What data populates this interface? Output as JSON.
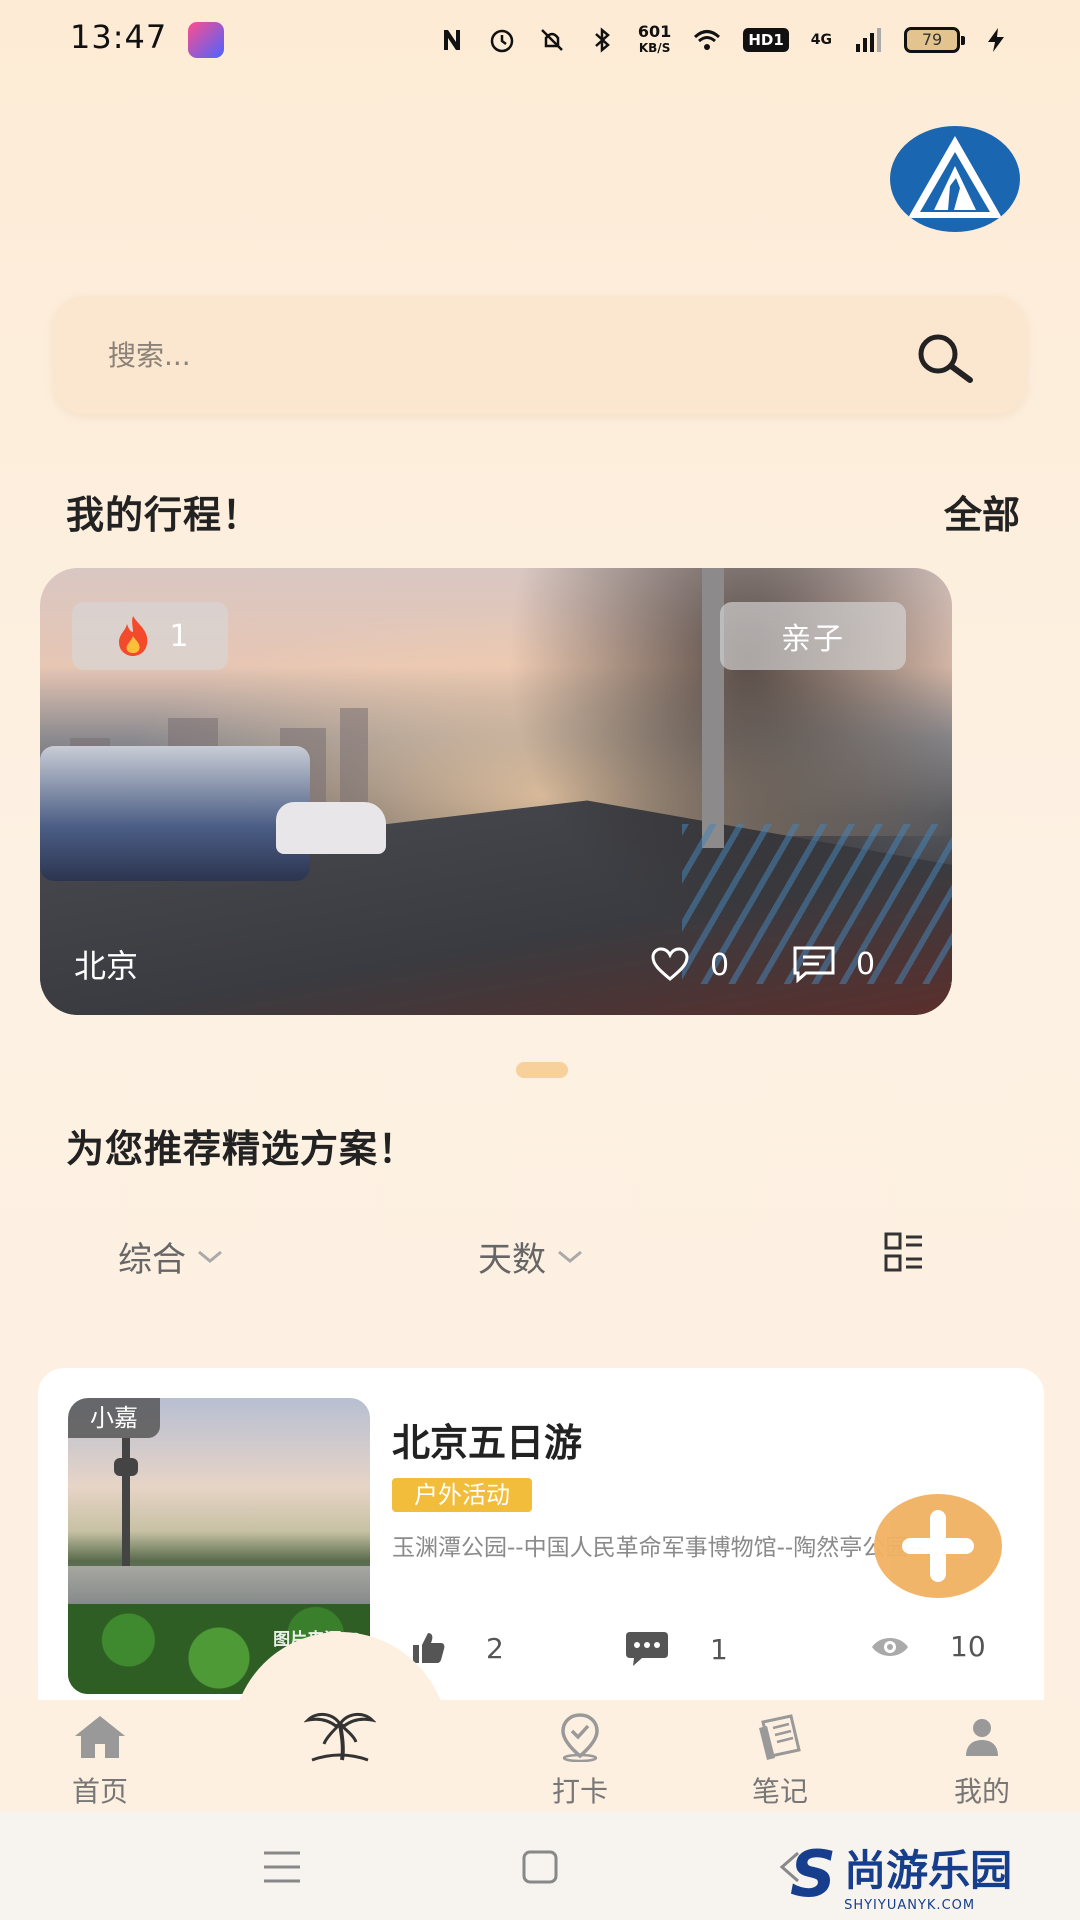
{
  "status_bar": {
    "time": "13:47",
    "net_speed_value": "601",
    "net_speed_unit": "KB/S",
    "hd_label": "HD1",
    "network_label": "4G",
    "battery": "79",
    "icons": [
      "nfc-icon",
      "alarm-icon",
      "silent-icon",
      "bluetooth-icon",
      "wifi-icon",
      "signal-icon",
      "charging-icon"
    ]
  },
  "search": {
    "placeholder": "搜索..."
  },
  "my_trips": {
    "title": "我的行程！",
    "all_link": "全部",
    "card": {
      "hot_count": "1",
      "tag": "亲子",
      "city": "北京",
      "likes": "0",
      "comments": "0"
    }
  },
  "recommend": {
    "title": "为您推荐精选方案！",
    "filters": [
      {
        "label": "综合"
      },
      {
        "label": "天数"
      }
    ]
  },
  "plan": {
    "author": "小嘉",
    "photo_source": "图片来源 ©",
    "title": "北京五日游",
    "tag": "户外活动",
    "route": "玉渊潭公园--中国人民革命军事博物馆--陶然亭公园--…",
    "thumbs": "2",
    "comments": "1",
    "views": "10"
  },
  "tabs": [
    {
      "label": "首页",
      "icon": "home-icon"
    },
    {
      "label": "",
      "icon": "palm-tree-icon"
    },
    {
      "label": "打卡",
      "icon": "location-check-icon"
    },
    {
      "label": "笔记",
      "icon": "notes-icon"
    },
    {
      "label": "我的",
      "icon": "profile-icon"
    }
  ],
  "watermark": {
    "cn": "尚游乐园",
    "en": "SHYIYUANYK.COM"
  },
  "colors": {
    "background": "#fdf0e1",
    "accent": "#f1b264",
    "tag": "#f2bd3a",
    "logo_blue": "#1b66b0"
  }
}
